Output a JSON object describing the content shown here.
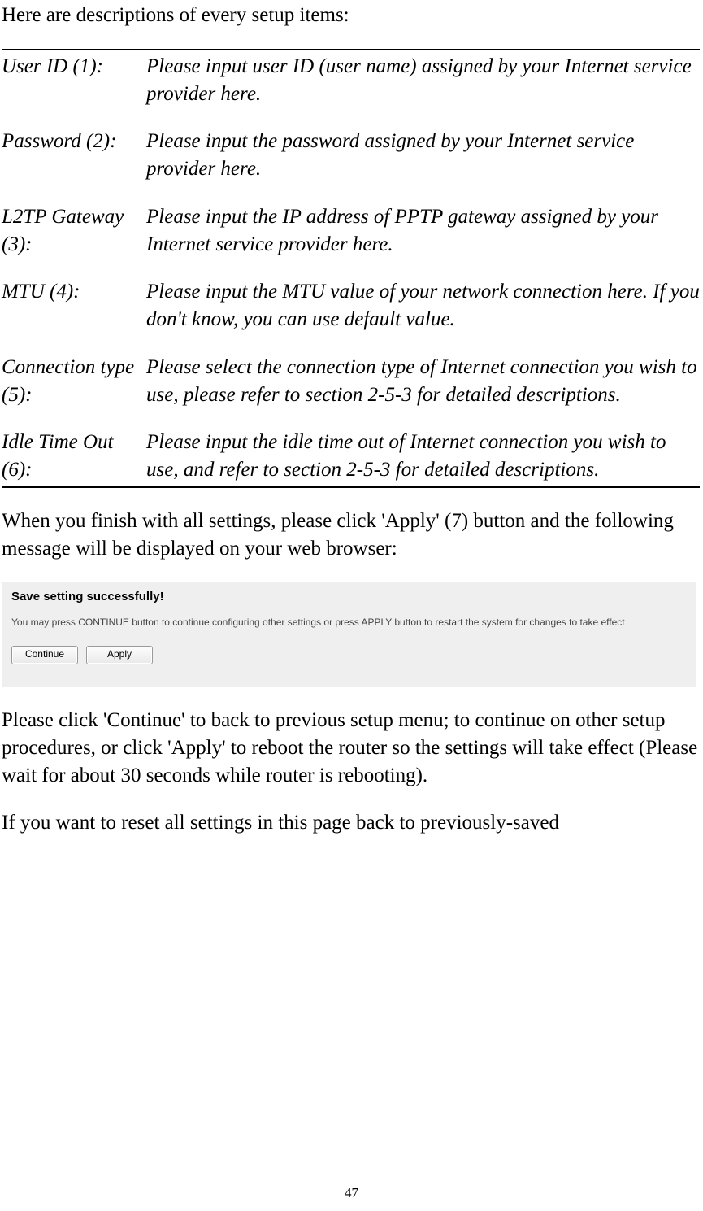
{
  "intro": "Here are descriptions of every setup items:",
  "rows": [
    {
      "label": "User ID (1):",
      "desc": "Please input user ID (user name) assigned by your Internet service provider here."
    },
    {
      "label": "Password (2):",
      "desc": "Please input the password assigned by your Internet service provider here."
    },
    {
      "label": "L2TP Gateway (3):",
      "desc": "Please input the IP address of PPTP gateway assigned by your Internet service provider here."
    },
    {
      "label": "MTU (4):",
      "desc": "Please input the MTU value of your network connection here. If you don't know, you can use default value."
    },
    {
      "label": "Connection type (5):",
      "desc": "Please select the connection type of Internet connection you wish to use, please refer to section 2-5-3 for detailed descriptions."
    },
    {
      "label": "Idle Time Out (6):",
      "desc": "Please input the idle time out of Internet connection you wish to use, and refer to section 2-5-3 for detailed descriptions."
    }
  ],
  "after_table": "When you finish with all settings, please click 'Apply' (7) button and the following message will be displayed on your web browser:",
  "dialog": {
    "title": "Save setting successfully!",
    "text": "You may press CONTINUE button to continue configuring other settings or press APPLY button to restart the system for changes to take effect",
    "continue_label": "Continue",
    "apply_label": "Apply"
  },
  "para1": "Please click 'Continue' to back to previous setup menu; to continue on other setup procedures, or click 'Apply' to reboot the router so the settings will take effect (Please wait for about 30 seconds while router is rebooting).",
  "para2": "If you want to reset all settings in this page back to previously-saved",
  "page_number": "47"
}
